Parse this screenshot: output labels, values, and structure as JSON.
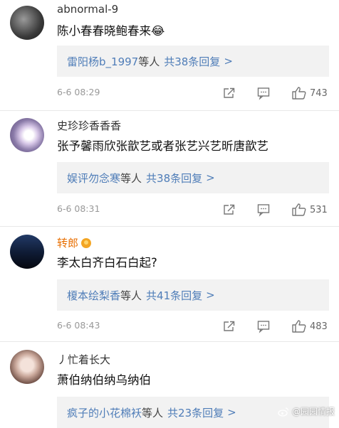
{
  "comments": [
    {
      "username": "abnormal-9",
      "text": "陈小春春晓鲍春来😂",
      "reply_names": "雷阳杨b_1997",
      "reply_suffix": "等人",
      "reply_count": "共38条回复",
      "reply_arrow": ">",
      "time": "6-6 08:29",
      "likes": "743"
    },
    {
      "username": "史珍珍香香香",
      "text": "张予馨雨欣张歆艺或者张艺兴艺昕唐歆艺",
      "reply_names": "娱评勿念寒",
      "reply_suffix": "等人",
      "reply_count": "共38条回复",
      "reply_arrow": ">",
      "time": "6-6 08:31",
      "likes": "531"
    },
    {
      "username": "转郎",
      "text": "李太白齐白石白起?",
      "reply_names": "榎本绘梨香",
      "reply_suffix": "等人",
      "reply_count": "共41条回复",
      "reply_arrow": ">",
      "time": "6-6 08:43",
      "likes": "483"
    },
    {
      "username": "丿忙着长大",
      "text": "萧伯纳伯纳乌纳伯",
      "reply_names": "疯子的小花棉袄",
      "reply_suffix": "等人",
      "reply_count": "共23条回复",
      "reply_arrow": ">"
    }
  ],
  "watermark": "@园园情报",
  "colors": {
    "link": "#4f7db8",
    "vip_name": "#e86e00",
    "reply_bg": "#f2f2f2"
  }
}
